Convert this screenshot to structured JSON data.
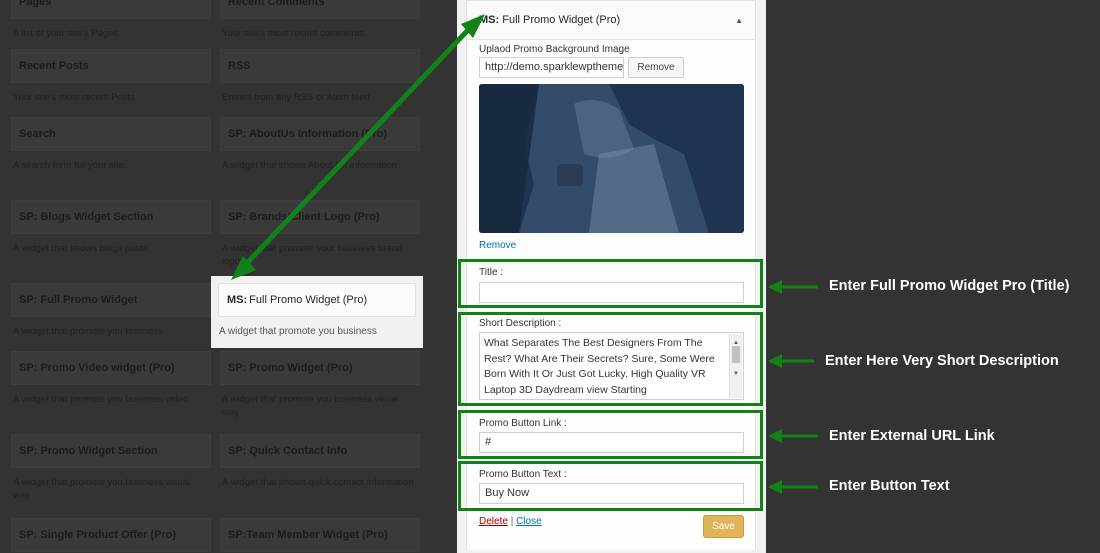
{
  "widgets": [
    {
      "title": "Pages",
      "desc": "A list of your site's Pages."
    },
    {
      "title": "Recent Comments",
      "desc": "Your site's most recent comments."
    },
    {
      "title": "Recent Posts",
      "desc": "Your site's most recent Posts."
    },
    {
      "title": "RSS",
      "desc": "Entries from any RSS or Atom feed."
    },
    {
      "title": "Search",
      "desc": "A search form for your site."
    },
    {
      "title": "SP: AboutUs Information (Pro)",
      "desc": "A widget that shows About Us information"
    },
    {
      "title": "SP: Blogs Widget Section",
      "desc": "A widget that shows blogs posts"
    },
    {
      "title": "SP: Brands/Client Logo (Pro)",
      "desc": "A widget that promote your business brand logo"
    },
    {
      "title": "SP: Full Promo Widget",
      "desc": "A widget that promote you business"
    },
    {
      "title": "SP: Promo Video widget (Pro)",
      "desc": "A widget that promote you business video"
    },
    {
      "title": "SP: Promo Widget (Pro)",
      "desc": "A widget that promote you business visual way"
    },
    {
      "title": "SP: Promo Widget Section",
      "desc": "A widget that promote you business visual way"
    },
    {
      "title": "SP: Quick Contact Info",
      "desc": "A widget that shows quick contact information"
    },
    {
      "title": "SP: Single Product Offer (Pro)",
      "desc": ""
    },
    {
      "title": "SP:Team Member Widget (Pro)",
      "desc": ""
    }
  ],
  "highlighted_widget": {
    "prefix": "MS:",
    "title": "Full Promo Widget (Pro)",
    "desc": "A widget that promote you business"
  },
  "panel": {
    "prefix": "MS:",
    "title": "Full Promo Widget (Pro)",
    "collapse_icon": "▲",
    "upload_label": "Uplaod Promo Background Image",
    "image_url": "http://demo.sparklewpthemes.com",
    "remove_button": "Remove",
    "remove_link": "Remove",
    "title_label": "Title :",
    "title_value": "",
    "short_desc_label": "Short Description :",
    "short_desc_value": "What Separates The Best Designers From The Rest? What Are Their Secrets? Sure, Some Were Born With It Or Just Got Lucky. High Quality VR Laptop 3D Daydream view Starting",
    "button_link_label": "Promo Button Link :",
    "button_link_value": "#",
    "button_text_label": "Promo Button Text :",
    "button_text_value": "Buy Now",
    "delete_link": "Delete",
    "separator": "|",
    "close_link": "Close",
    "save_button": "Save"
  },
  "annotations": {
    "title": "Enter Full Promo Widget Pro (Title)",
    "short_desc": "Enter Here Very Short Description",
    "url": "Enter External URL Link",
    "button_text": "Enter Button Text"
  },
  "colors": {
    "annotation_green": "#108218",
    "save_button": "#e1b45a",
    "link_blue": "#0073aa",
    "background": "#333333"
  }
}
